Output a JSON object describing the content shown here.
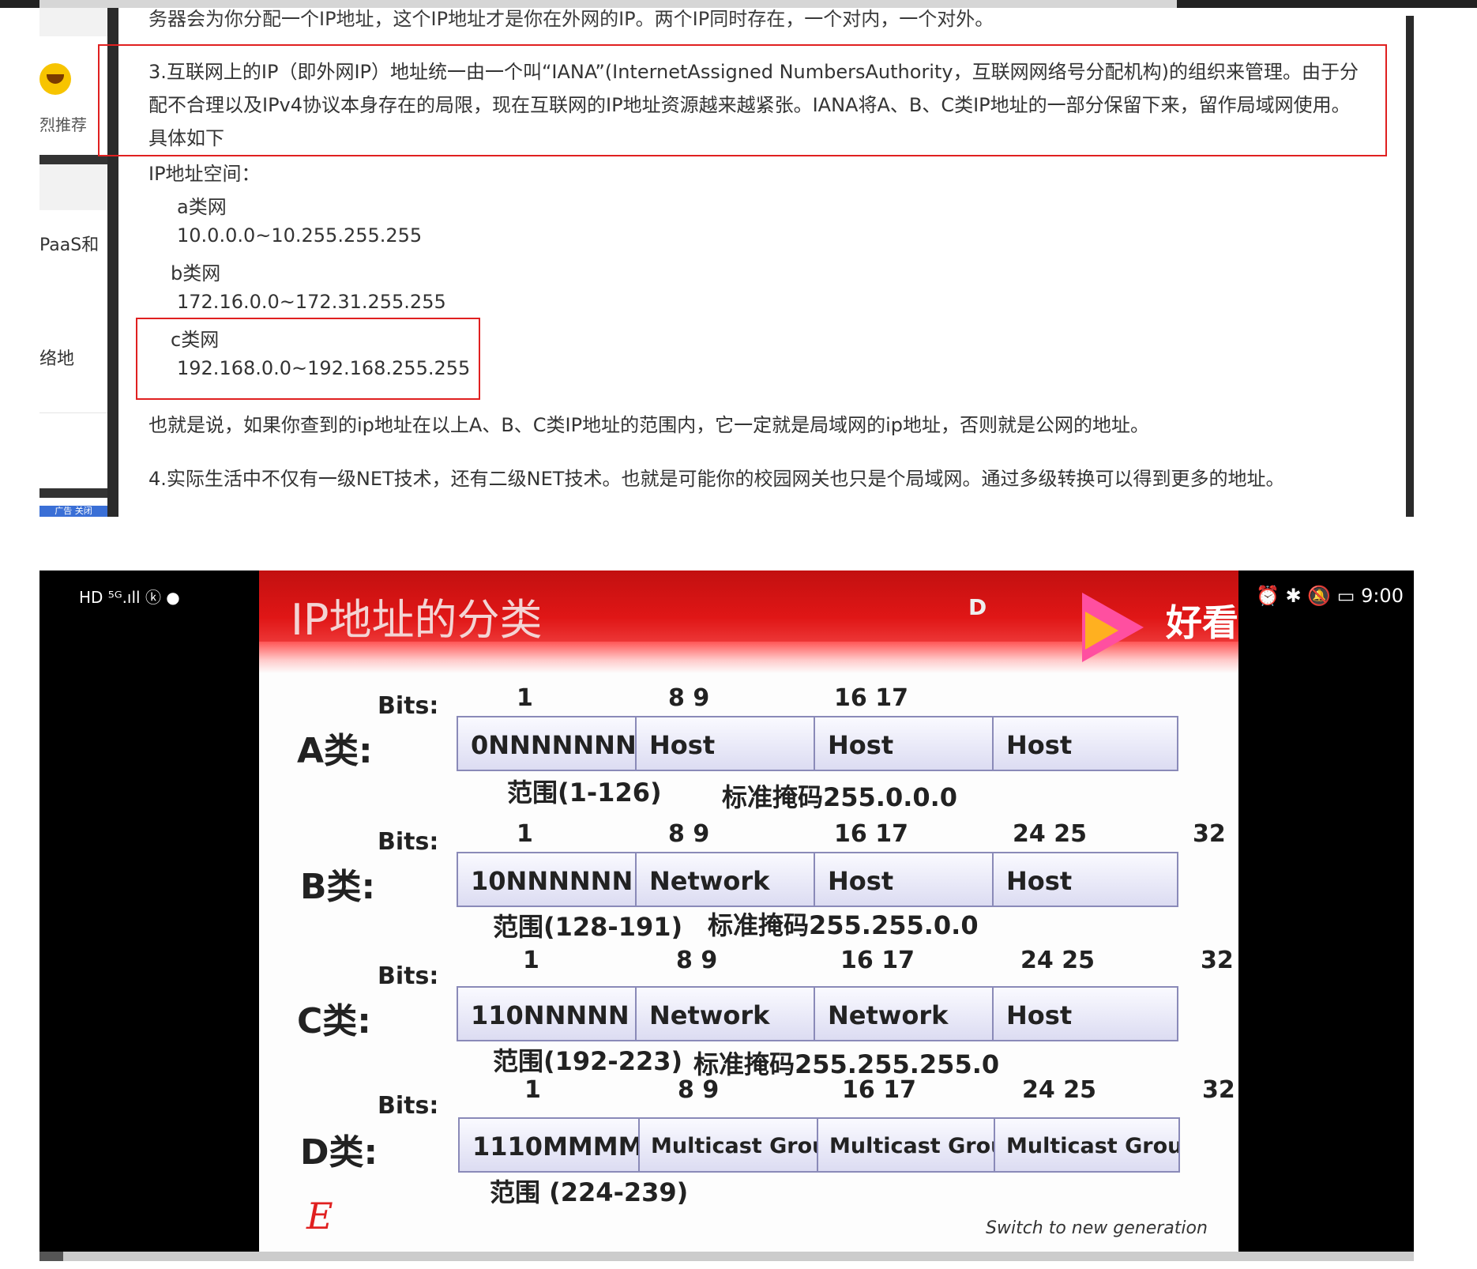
{
  "sidebar": {
    "recommend": "烈推荐",
    "paas": "PaaS和",
    "network": "络地",
    "ad": "广告 关闭"
  },
  "article": {
    "cut_line": "务器会为你分配一个IP地址，这个IP地址才是你在外网的IP。两个IP同时存在，一个对内，一个对外。",
    "para3": "3.互联网上的IP（即外网IP）地址统一由一个叫“IANA”(InternetAssigned NumbersAuthority，互联网网络号分配机构)的组织来管理。由于分配不合理以及IPv4协议本身存在的局限，现在互联网的IP地址资源越来越紧张。IANA将A、B、C类IP地址的一部分保留下来，留作局域网使用。具体如下",
    "space_label": "IP地址空间：",
    "a_label": "a类网",
    "a_range": "10.0.0.0~10.255.255.255",
    "b_label": "b类网",
    "b_range": "172.16.0.0~172.31.255.255",
    "c_label": "c类网",
    "c_range": "192.168.0.0~192.168.255.255",
    "summary": "也就是说，如果你查到的ip地址在以上A、B、C类IP地址的范围内，它一定就是局域网的ip地址，否则就是公网的地址。",
    "para4": "4.实际生活中不仅有一级NET技术，还有二级NET技术。也就是可能你的校园网关也只是个局域网。通过多级转换可以得到更多的地址。"
  },
  "video": {
    "status_left": "HD ⁵ᴳ.ıll ⓚ ●",
    "status_right": "⏰ ✱ 🔕 ▭ 9:00",
    "slide_title": "IP地址的分类",
    "logo_d": "D",
    "logo_text": "好看视频",
    "bits_label": "Bits:",
    "classes": [
      {
        "name": "A类:",
        "bits": [
          "1",
          "8  9",
          "16  17"
        ],
        "cells": [
          "0NNNNNNN",
          "Host",
          "Host",
          "Host"
        ],
        "range": "范围(1-126)",
        "mask": "标准掩码255.0.0.0"
      },
      {
        "name": "B类:",
        "bits": [
          "1",
          "8  9",
          "16  17",
          "24  25",
          "32"
        ],
        "cells": [
          "10NNNNNN",
          "Network",
          "Host",
          "Host"
        ],
        "range": "范围(128-191)",
        "mask": "标准掩码255.255.0.0"
      },
      {
        "name": "C类:",
        "bits": [
          "1",
          "8  9",
          "16  17",
          "24 25",
          "32"
        ],
        "cells": [
          "110NNNNN",
          "Network",
          "Network",
          "Host"
        ],
        "range": "范围(192-223)",
        "mask": "标准掩码255.255.255.0"
      },
      {
        "name": "D类:",
        "bits": [
          "1",
          "8  9",
          "16  17",
          "24 25",
          "32"
        ],
        "cells": [
          "1110MMMM",
          "Multicast Group",
          "Multicast Group",
          "Multicast Group"
        ],
        "range": "范围 (224-239)"
      }
    ],
    "e_mark": "E",
    "switch_text": "Switch to new generation"
  }
}
